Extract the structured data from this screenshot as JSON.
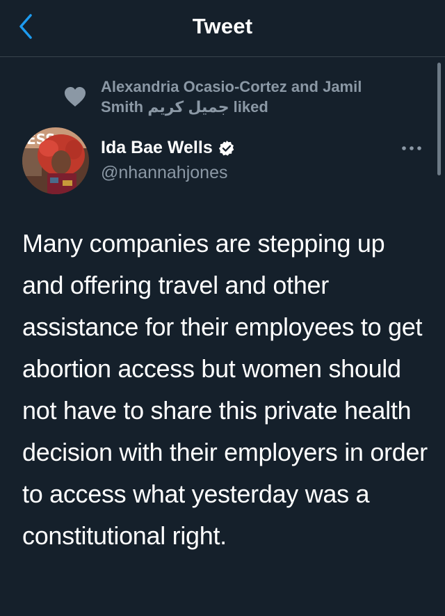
{
  "header": {
    "title": "Tweet",
    "back_icon": "chevron-left-icon",
    "accent_color": "#1d9bf0"
  },
  "social_context": {
    "icon": "heart-icon",
    "text": "Alexandria Ocasio-Cortez and Jamil Smith جميل كريم liked"
  },
  "tweet": {
    "author": {
      "name": "Ida Bae Wells",
      "handle": "@nhannahjones",
      "verified": true,
      "avatar": "avatar-photo"
    },
    "more_icon": "more-options-icon",
    "text": "Many companies are stepping up and offering travel and other assistance for their employees to get abortion access but women should not have to share this private health decision with their employers in order to access what yesterday was a constitutional right."
  },
  "colors": {
    "background": "#15202b",
    "secondary_text": "#8b98a5",
    "divider": "#38444d"
  }
}
